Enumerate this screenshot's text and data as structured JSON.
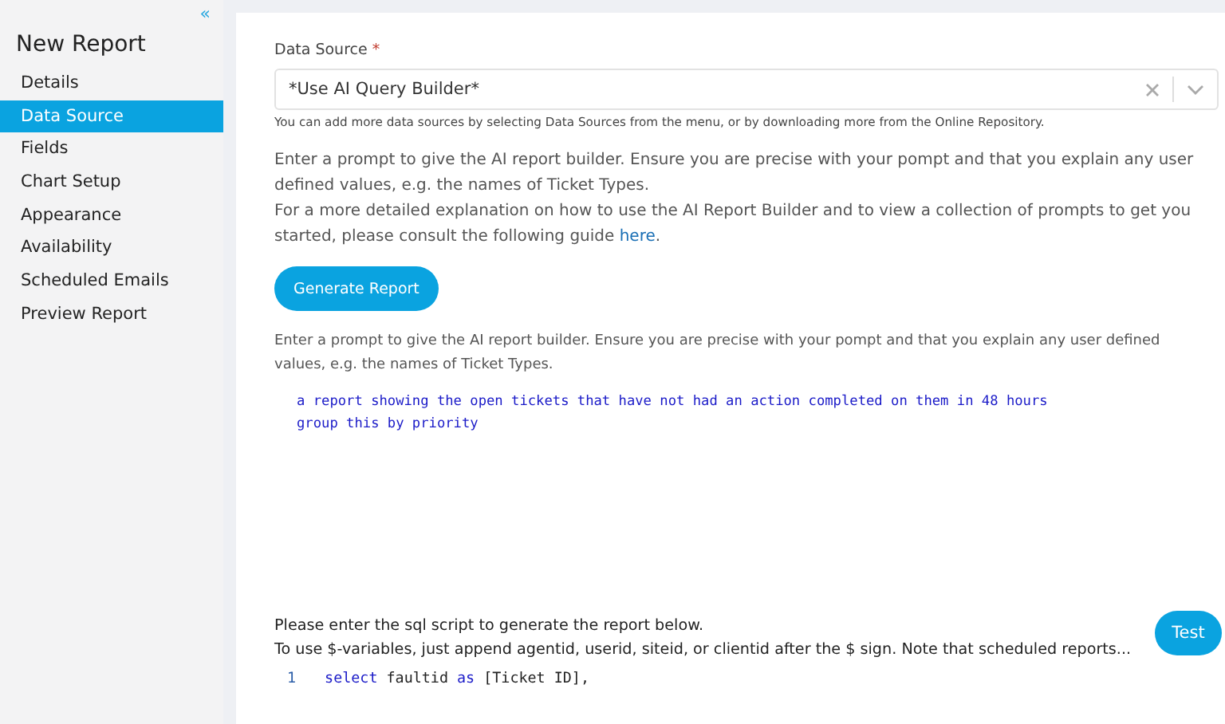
{
  "sidebar": {
    "collapse_icon": "«",
    "title": "New Report",
    "items": [
      {
        "label": "Details",
        "selected": false
      },
      {
        "label": "Data Source",
        "selected": true
      },
      {
        "label": "Fields",
        "selected": false
      },
      {
        "label": "Chart Setup",
        "selected": false
      },
      {
        "label": "Appearance",
        "selected": false
      },
      {
        "label": "Availability",
        "selected": false
      },
      {
        "label": "Scheduled Emails",
        "selected": false
      },
      {
        "label": "Preview Report",
        "selected": false
      }
    ]
  },
  "data_source": {
    "label": "Data Source",
    "required_mark": "*",
    "value": "*Use AI Query Builder*",
    "help": "You can add more data sources by selecting Data Sources from the menu, or by downloading more from the Online Repository."
  },
  "intro": {
    "line_1": "Enter a prompt to give the AI report builder. Ensure you are precise with your pompt and that you explain any user defined values, e.g. the names of Ticket Types.",
    "line_2": "For a more detailed explanation on how to use the AI Report Builder and to view a collection of prompts to get you started, please consult the following guide",
    "link": "here",
    "after_link": "."
  },
  "generate_button": "Generate Report",
  "prompt": {
    "hint": "Enter a prompt to give the AI report builder. Ensure you are precise with your pompt and that you explain any user defined values, e.g. the names of Ticket Types.",
    "lines": [
      "a report showing the open tickets that have not had an action completed on them in 48 hours",
      "group this by priority"
    ]
  },
  "sql": {
    "line_1": "Please enter the sql script to generate the report below.",
    "line_2": "To use $-variables, just append agentid, userid, siteid, or clientid after the $ sign. Note that scheduled reports...",
    "test_button": "Test",
    "code": [
      {
        "number": "1",
        "tokens": [
          {
            "text": "select",
            "kind": "keyword"
          },
          {
            "text": "faultid",
            "kind": "plain"
          },
          {
            "text": "as",
            "kind": "keyword"
          },
          {
            "text": "[Ticket ID],",
            "kind": "plain"
          }
        ]
      }
    ]
  }
}
